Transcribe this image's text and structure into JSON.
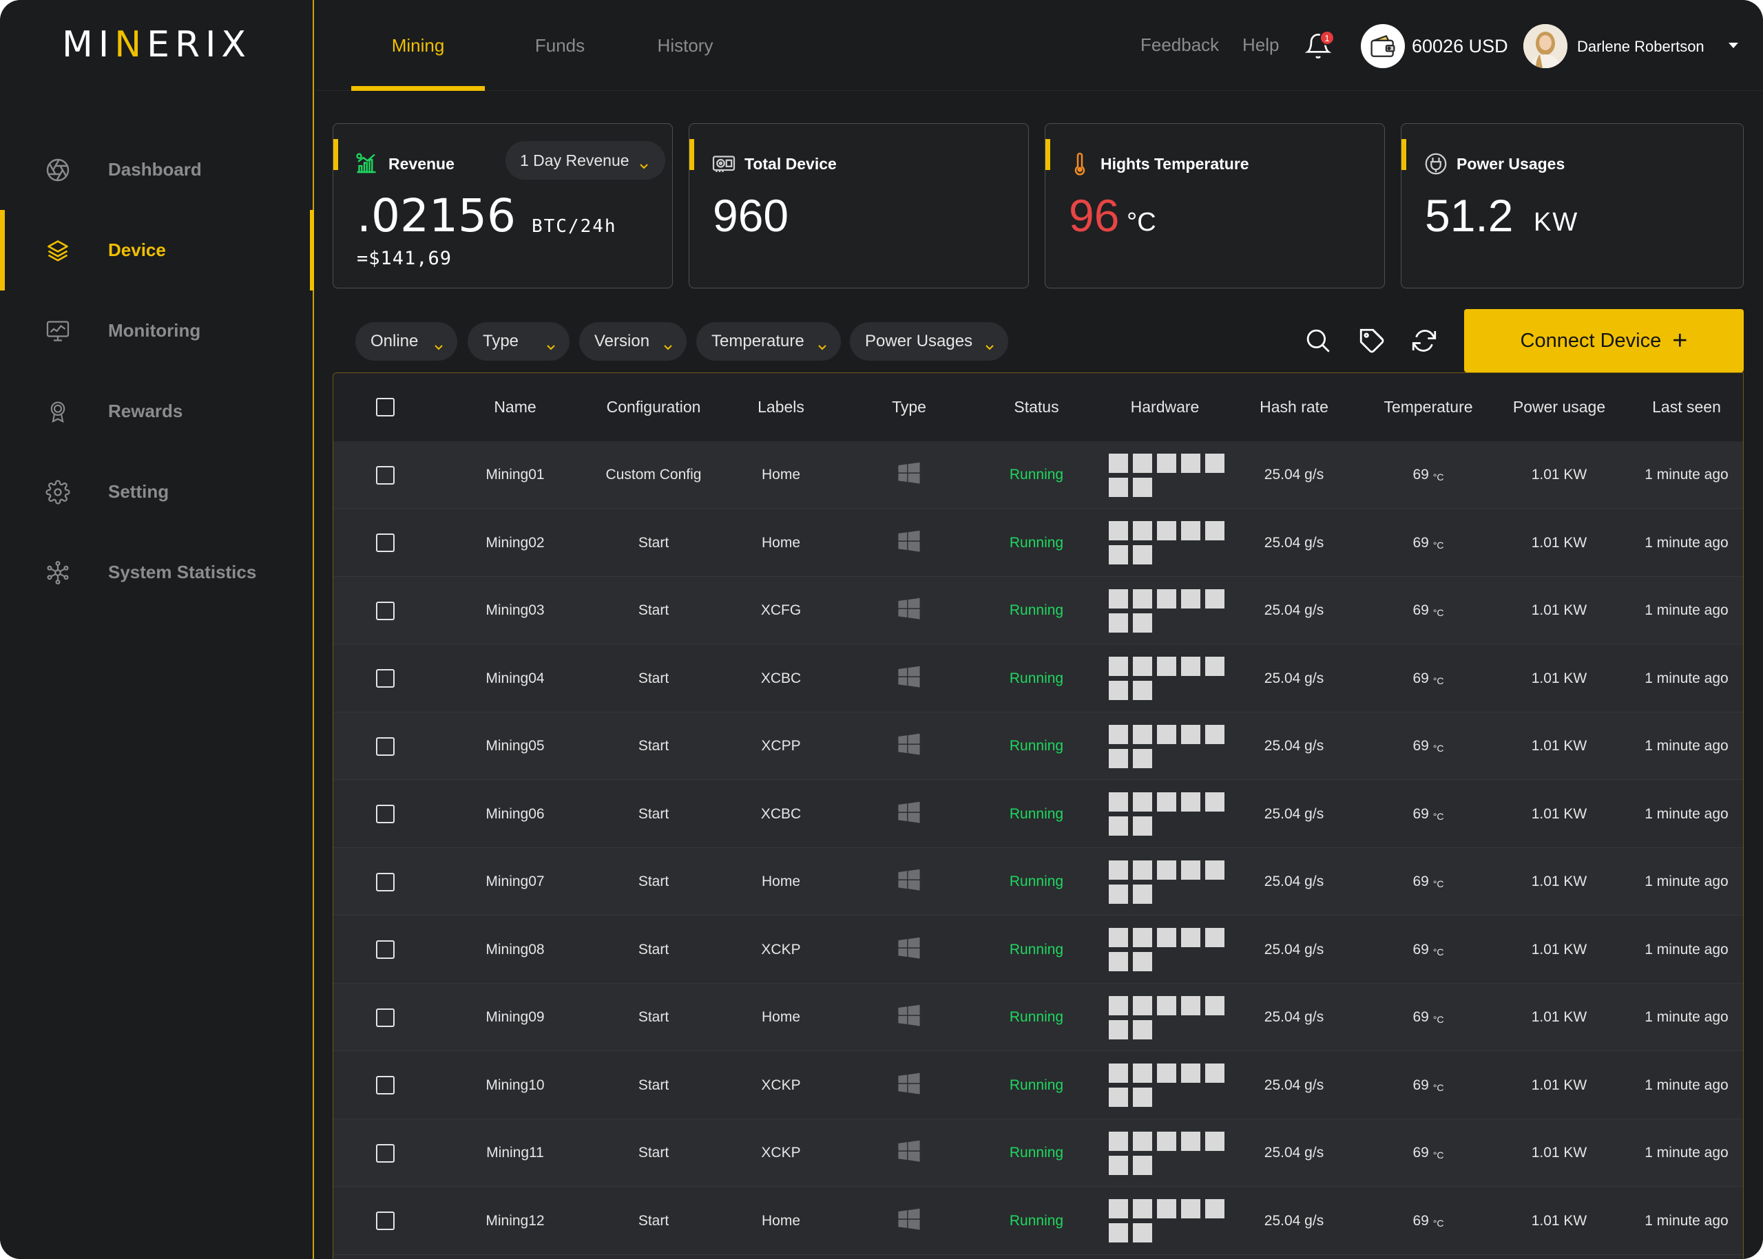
{
  "app": {
    "logo_text_pre": "MI",
    "logo_text_accent": "N",
    "logo_text_post": "ERIX"
  },
  "sidebar": {
    "items": [
      {
        "label": "Dashboard",
        "icon": "aperture-icon",
        "active": false
      },
      {
        "label": "Device",
        "icon": "layers-icon",
        "active": true
      },
      {
        "label": "Monitoring",
        "icon": "monitor-icon",
        "active": false
      },
      {
        "label": "Rewards",
        "icon": "award-icon",
        "active": false
      },
      {
        "label": "Setting",
        "icon": "gear-icon",
        "active": false
      },
      {
        "label": "System Statistics",
        "icon": "network-icon",
        "active": false
      }
    ]
  },
  "topbar": {
    "tabs": [
      {
        "label": "Mining",
        "active": true
      },
      {
        "label": "Funds",
        "active": false
      },
      {
        "label": "History",
        "active": false
      }
    ],
    "feedback": "Feedback",
    "help": "Help",
    "notification_count": "1",
    "balance": "60026 USD",
    "user_name": "Darlene Robertson"
  },
  "cards": {
    "revenue": {
      "title": "Revenue",
      "dropdown": "1 Day Revenue",
      "value": ".02156",
      "unit": "BTC/24h",
      "usd": "=$141,69"
    },
    "total_device": {
      "title": "Total Device",
      "value": "960"
    },
    "temperature": {
      "title": "Hights Temperature",
      "value": "96",
      "unit": "°C",
      "value_color": "#e84545"
    },
    "power": {
      "title": "Power Usages",
      "value": "51.2",
      "unit": "KW"
    }
  },
  "filters": [
    "Online",
    "Type",
    "Version",
    "Temperature",
    "Power Usages"
  ],
  "connect_button": "Connect Device",
  "colors": {
    "accent": "#f0c000",
    "running": "#1ed760",
    "danger": "#e84545"
  },
  "table": {
    "headers": [
      "Name",
      "Configuration",
      "Labels",
      "Type",
      "Status",
      "Hardware",
      "Hash rate",
      "Temperature",
      "Power usage",
      "Last seen"
    ],
    "rows": [
      {
        "name": "Mining01",
        "config": "Custom Config",
        "label": "Home",
        "status": "Running",
        "hash": "25.04 g/s",
        "temp": "69",
        "temp_unit": "°C",
        "power": "1.01 KW",
        "last": "1 minute ago"
      },
      {
        "name": "Mining02",
        "config": "Start",
        "label": "Home",
        "status": "Running",
        "hash": "25.04 g/s",
        "temp": "69",
        "temp_unit": "°C",
        "power": "1.01 KW",
        "last": "1 minute ago"
      },
      {
        "name": "Mining03",
        "config": "Start",
        "label": "XCFG",
        "status": "Running",
        "hash": "25.04 g/s",
        "temp": "69",
        "temp_unit": "°C",
        "power": "1.01 KW",
        "last": "1 minute ago"
      },
      {
        "name": "Mining04",
        "config": "Start",
        "label": "XCBC",
        "status": "Running",
        "hash": "25.04 g/s",
        "temp": "69",
        "temp_unit": "°C",
        "power": "1.01 KW",
        "last": "1 minute ago"
      },
      {
        "name": "Mining05",
        "config": "Start",
        "label": "XCPP",
        "status": "Running",
        "hash": "25.04 g/s",
        "temp": "69",
        "temp_unit": "°C",
        "power": "1.01 KW",
        "last": "1 minute ago"
      },
      {
        "name": "Mining06",
        "config": "Start",
        "label": "XCBC",
        "status": "Running",
        "hash": "25.04 g/s",
        "temp": "69",
        "temp_unit": "°C",
        "power": "1.01 KW",
        "last": "1 minute ago"
      },
      {
        "name": "Mining07",
        "config": "Start",
        "label": "Home",
        "status": "Running",
        "hash": "25.04 g/s",
        "temp": "69",
        "temp_unit": "°C",
        "power": "1.01 KW",
        "last": "1 minute ago"
      },
      {
        "name": "Mining08",
        "config": "Start",
        "label": "XCKP",
        "status": "Running",
        "hash": "25.04 g/s",
        "temp": "69",
        "temp_unit": "°C",
        "power": "1.01 KW",
        "last": "1 minute ago"
      },
      {
        "name": "Mining09",
        "config": "Start",
        "label": "Home",
        "status": "Running",
        "hash": "25.04 g/s",
        "temp": "69",
        "temp_unit": "°C",
        "power": "1.01 KW",
        "last": "1 minute ago"
      },
      {
        "name": "Mining10",
        "config": "Start",
        "label": "XCKP",
        "status": "Running",
        "hash": "25.04 g/s",
        "temp": "69",
        "temp_unit": "°C",
        "power": "1.01 KW",
        "last": "1 minute ago"
      },
      {
        "name": "Mining11",
        "config": "Start",
        "label": "XCKP",
        "status": "Running",
        "hash": "25.04 g/s",
        "temp": "69",
        "temp_unit": "°C",
        "power": "1.01 KW",
        "last": "1 minute ago"
      },
      {
        "name": "Mining12",
        "config": "Start",
        "label": "Home",
        "status": "Running",
        "hash": "25.04 g/s",
        "temp": "69",
        "temp_unit": "°C",
        "power": "1.01 KW",
        "last": "1 minute ago"
      }
    ]
  }
}
